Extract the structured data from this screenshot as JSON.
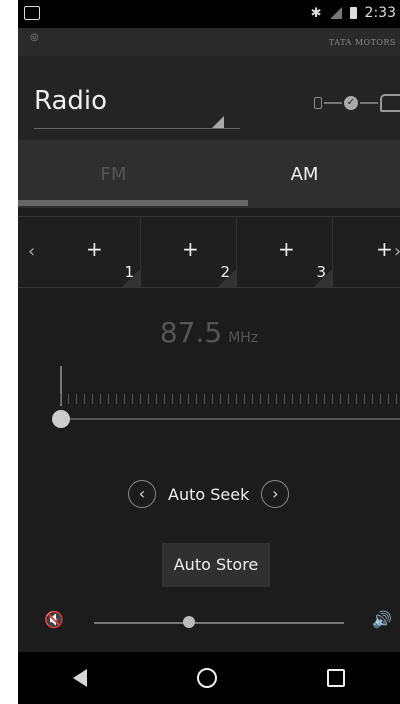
{
  "status": {
    "time": "2:33",
    "bt": "✱"
  },
  "brand": {
    "text": "TATA MOTORS",
    "logo": "◎"
  },
  "header": {
    "title": "Radio"
  },
  "tabs": [
    {
      "label": "FM"
    },
    {
      "label": "AM"
    }
  ],
  "presets": [
    {
      "plus": "+",
      "num": "1"
    },
    {
      "plus": "+",
      "num": "2"
    },
    {
      "plus": "+",
      "num": "3"
    },
    {
      "plus": "+",
      "num": ""
    }
  ],
  "freq": {
    "value": "87.5",
    "unit": "MHz"
  },
  "seek": {
    "label": "Auto Seek",
    "prev": "‹",
    "next": "›"
  },
  "autostore": {
    "label": "Auto Store"
  },
  "volume": {
    "level": 0.38,
    "mute_icon": "🔇",
    "vol_icon": "🔊"
  }
}
